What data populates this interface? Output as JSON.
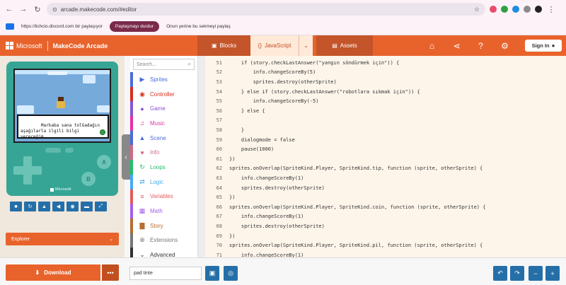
{
  "browser": {
    "url": "arcade.makecode.com/#editor"
  },
  "share_bar": {
    "site": "https://lichcio.discord.com bir paylaşıyor",
    "active_label": "Paylaşmayı durdur",
    "secondary_label": "Onun yerine bu sekmeyi paylaş"
  },
  "header": {
    "brand": "Microsoft",
    "app_title": "MakeCode Arcade",
    "tabs": [
      {
        "label": "Blocks",
        "icon": "puzzle-icon"
      },
      {
        "label": "JavaScript",
        "icon": "code-icon"
      },
      {
        "label": "Assets",
        "icon": "assets-icon"
      }
    ],
    "signin_label": "Sign In"
  },
  "simulator": {
    "dialog_text": "Markaba sana tolGadağın\naşağılarla ilgili bilgi\nvereceğim",
    "brand_label": "Microsoft",
    "buttons": [
      "A",
      "B"
    ]
  },
  "explorer_label": "Explorer",
  "toolbox": {
    "search_placeholder": "Search...",
    "categories": [
      {
        "label": "Sprites",
        "color": "#4b6cda",
        "icon": "▶"
      },
      {
        "label": "Controller",
        "color": "#d6301d",
        "icon": "◉"
      },
      {
        "label": "Game",
        "color": "#8854d0",
        "icon": "●"
      },
      {
        "label": "Music",
        "color": "#e52fa3",
        "icon": "♫"
      },
      {
        "label": "Scene",
        "color": "#4b6cda",
        "icon": "▲"
      },
      {
        "label": "Info",
        "color": "#cf6a87",
        "icon": "♥"
      },
      {
        "label": "Loops",
        "color": "#20bf6b",
        "icon": "↻"
      },
      {
        "label": "Logic",
        "color": "#45aaf2",
        "icon": "⇄"
      },
      {
        "label": "Variables",
        "color": "#e55b5b",
        "icon": "≡"
      },
      {
        "label": "Math",
        "color": "#a55eea",
        "icon": "▦"
      },
      {
        "label": "Story",
        "color": "#b76d2e",
        "icon": "▇"
      },
      {
        "label": "Extensions",
        "color": "#777777",
        "icon": "⊕"
      },
      {
        "label": "Advanced",
        "color": "#333333",
        "icon": "⌄"
      }
    ]
  },
  "code_lines": [
    {
      "num": "51",
      "text": "    if (story.checkLastAnswer(\"yangın söndürmek için\")) {"
    },
    {
      "num": "52",
      "text": "        info.changeScoreBy(5)"
    },
    {
      "num": "53",
      "text": "        sprites.destroy(otherSprite)"
    },
    {
      "num": "54",
      "text": "    } else if (story.checkLastAnswer(\"robotlara sıkmak için\")) {"
    },
    {
      "num": "55",
      "text": "        info.changeScoreBy(-5)"
    },
    {
      "num": "56",
      "text": "    } else {"
    },
    {
      "num": "57",
      "text": ""
    },
    {
      "num": "58",
      "text": "    }"
    },
    {
      "num": "59",
      "text": "    dialogmode = false"
    },
    {
      "num": "60",
      "text": "    pause(1000)"
    },
    {
      "num": "61",
      "text": "})"
    },
    {
      "num": "62",
      "text": "sprites.onOverlap(SpriteKind.Player, SpriteKind.tip, function (sprite, otherSprite) {"
    },
    {
      "num": "63",
      "text": "    info.changeScoreBy(1)"
    },
    {
      "num": "64",
      "text": "    sprites.destroy(otherSprite)"
    },
    {
      "num": "65",
      "text": "})"
    },
    {
      "num": "66",
      "text": "sprites.onOverlap(SpriteKind.Player, SpriteKind.coin, function (sprite, otherSprite) {"
    },
    {
      "num": "67",
      "text": "    info.changeScoreBy(1)"
    },
    {
      "num": "68",
      "text": "    sprites.destroy(otherSprite)"
    },
    {
      "num": "69",
      "text": "})"
    },
    {
      "num": "70",
      "text": "sprites.onOverlap(SpriteKind.Player, SpriteKind.pil, function (sprite, otherSprite) {"
    },
    {
      "num": "71",
      "text": "    info.changeScoreBy(1)"
    }
  ],
  "bottom": {
    "download_label": "Download",
    "more_label": "•••",
    "project_name": "pad tinte"
  }
}
